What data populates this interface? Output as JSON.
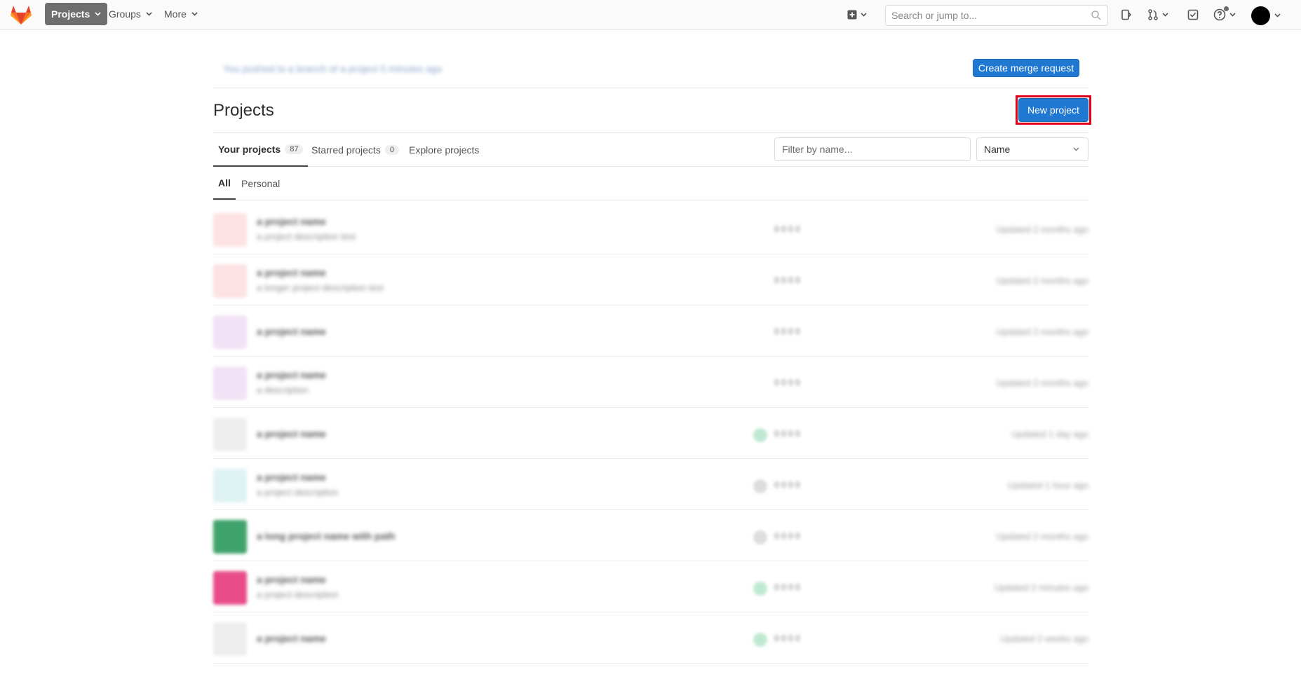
{
  "nav": {
    "projects_label": "Projects",
    "groups_label": "Groups",
    "more_label": "More",
    "search_placeholder": "Search or jump to..."
  },
  "alert": {
    "text": "You pushed to a branch of a project 5 minutes ago",
    "create_mr_label": "Create merge request"
  },
  "page": {
    "title": "Projects",
    "new_project_label": "New project"
  },
  "tabs": [
    {
      "label": "Your projects",
      "count": "87"
    },
    {
      "label": "Starred projects",
      "count": "0"
    },
    {
      "label": "Explore projects"
    }
  ],
  "filter": {
    "placeholder": "Filter by name...",
    "sort_selected": "Name"
  },
  "subtabs": [
    "All",
    "Personal"
  ],
  "projects": [
    {
      "name": "a project name",
      "desc": "a project description text",
      "stats": "0  0  0  0",
      "updated": "Updated 2 months ago",
      "avatar_color": "#fde2e4"
    },
    {
      "name": "a project name",
      "desc": "a longer project description text",
      "stats": "0  0  0  0",
      "updated": "Updated 2 months ago",
      "avatar_color": "#fde2e4"
    },
    {
      "name": "a project name",
      "desc": "",
      "stats": "0  0  0  0",
      "updated": "Updated 2 months ago",
      "avatar_color": "#f2e2f5"
    },
    {
      "name": "a project name",
      "desc": "a description",
      "stats": "0  0  0  0",
      "updated": "Updated 2 months ago",
      "avatar_color": "#f2e2f5"
    },
    {
      "name": "a project name",
      "desc": "",
      "stats": "0  0  0  0",
      "updated": "Updated 1 day ago",
      "avatar_color": "#eeeeee"
    },
    {
      "name": "a project name",
      "desc": "a project description",
      "stats": "0  0  0  0",
      "updated": "Updated 1 hour ago",
      "avatar_color": "#def3f3"
    },
    {
      "name": "a long project name with path",
      "desc": "",
      "stats": "0  0  0  0",
      "updated": "Updated 2 months ago",
      "avatar_color": "#3fa36b"
    },
    {
      "name": "a project name",
      "desc": "a project description",
      "stats": "0  0  0  0",
      "updated": "Updated 2 minutes ago",
      "avatar_color": "#e84d8a"
    },
    {
      "name": "a project name",
      "desc": "",
      "stats": "0  0  0  0",
      "updated": "Updated 2 weeks ago",
      "avatar_color": "#eeeeee"
    }
  ]
}
